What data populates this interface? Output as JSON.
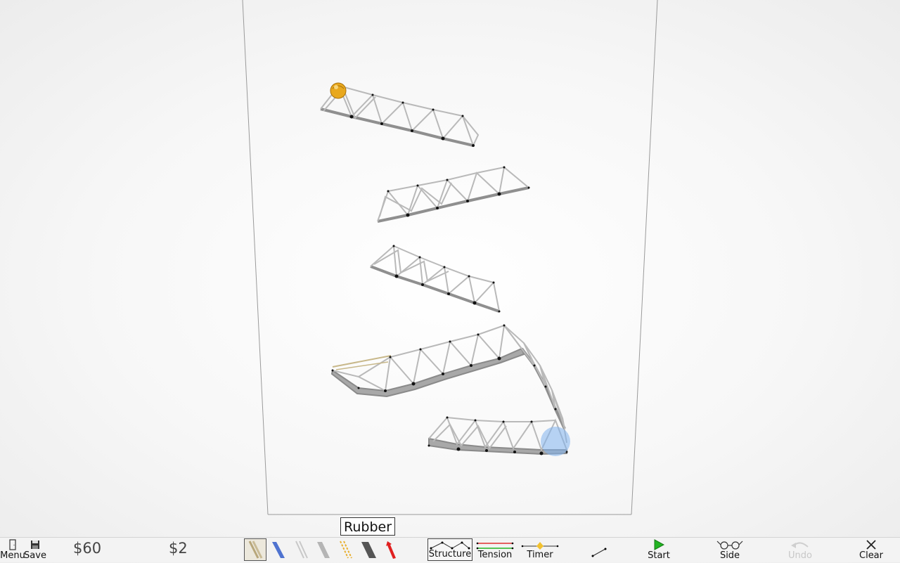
{
  "tooltip": "Rubber",
  "toolbar": {
    "menu_label": "Menu",
    "save_label": "Save",
    "budget": "$60",
    "cost": "$2",
    "materials": [
      {
        "name": "wood",
        "selected": true
      },
      {
        "name": "blue-plank",
        "selected": false
      },
      {
        "name": "cable",
        "selected": false
      },
      {
        "name": "steel",
        "selected": false
      },
      {
        "name": "rubber",
        "selected": false
      },
      {
        "name": "road",
        "selected": false
      },
      {
        "name": "rocket",
        "selected": false
      }
    ],
    "modes": [
      {
        "label": "Structure",
        "selected": true
      },
      {
        "label": "Tension",
        "selected": false
      },
      {
        "label": "Timer",
        "selected": false
      }
    ],
    "start_label": "Start",
    "side_label": "Side",
    "undo_label": "Undo",
    "undo_enabled": false,
    "clear_label": "Clear"
  },
  "colors": {
    "start_arrow": "#22b422",
    "ball": "#e8a81e",
    "goal": "#7fb2ee",
    "wood": "#c9bb95",
    "blue": "#4f73d0",
    "rubber": "#e8b030",
    "rocket": "#e02020"
  }
}
